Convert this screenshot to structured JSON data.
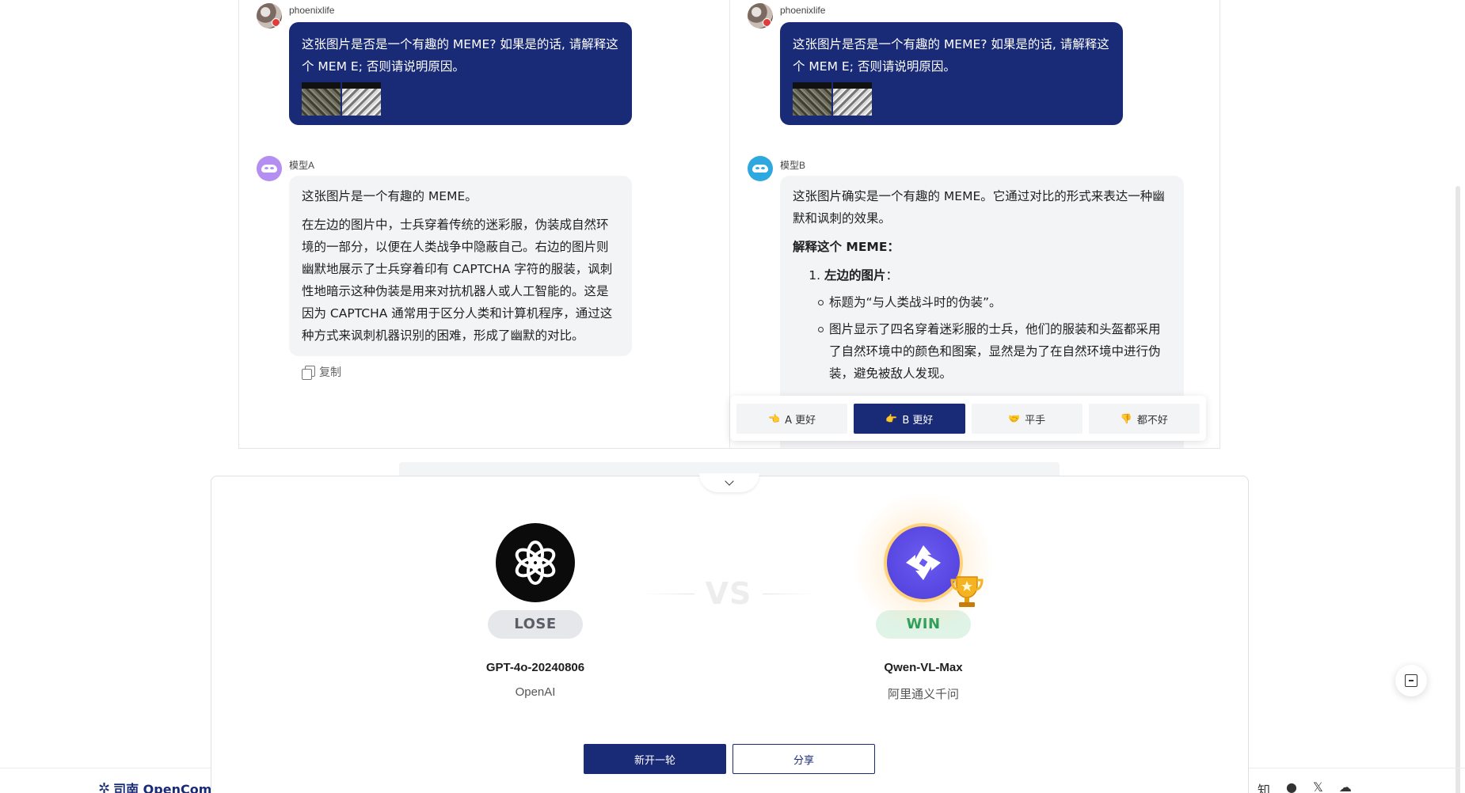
{
  "left_column": {
    "user": {
      "name": "phoenixlife",
      "message": "这张图片是否是一个有趣的 MEME? 如果是的话, 请解释这个 MEM E; 否则请说明原因。"
    },
    "model": {
      "name": "模型A",
      "paragraphs": [
        "这张图片是一个有趣的 MEME。",
        "在左边的图片中，士兵穿着传统的迷彩服，伪装成自然环境的一部分，以便在人类战争中隐蔽自己。右边的图片则幽默地展示了士兵穿着印有 CAPTCHA 字符的服装，讽刺性地暗示这种伪装是用来对抗机器人或人工智能的。这是因为 CAPTCHA 通常用于区分人类和计算机程序，通过这种方式来讽刺机器识别的困难，形成了幽默的对比。"
      ],
      "copy_label": "复制"
    }
  },
  "right_column": {
    "user": {
      "name": "phoenixlife",
      "message": "这张图片是否是一个有趣的 MEME? 如果是的话, 请解释这个 MEM E; 否则请说明原因。"
    },
    "model": {
      "name": "模型B",
      "intro": "这张图片确实是一个有趣的 MEME。它通过对比的形式来表达一种幽默和讽刺的效果。",
      "heading": "解释这个 MEME：",
      "list_item_1": "左边的图片",
      "list_item_1_suffix": "：",
      "bullets": [
        "标题为“与人类战斗时的伪装”。",
        "图片显示了四名穿着迷彩服的士兵，他们的服装和头盔都采用了自然环境中的颜色和图案，显然是为了在自然环境中进行伪装，避免被敌人发现。"
      ]
    }
  },
  "vote": {
    "buttons": [
      {
        "emoji": "👈",
        "label": "A 更好",
        "active": false
      },
      {
        "emoji": "👉",
        "label": "B 更好",
        "active": true
      },
      {
        "emoji": "🤝",
        "label": "平手",
        "active": false
      },
      {
        "emoji": "👎",
        "label": "都不好",
        "active": false
      }
    ]
  },
  "result": {
    "vs_text": "VS",
    "loser": {
      "badge": "LOSE",
      "name": "GPT-4o-20240806",
      "org": "OpenAI"
    },
    "winner": {
      "badge": "WIN",
      "name": "Qwen-VL-Max",
      "org": "阿里通义千问"
    },
    "new_round_label": "新开一轮",
    "share_label": "分享"
  },
  "footer": {
    "brand": "司南 OpenCompass",
    "icons": [
      "知",
      "github-icon",
      "x-icon",
      "wechat-icon"
    ]
  },
  "colors": {
    "primary": "#192a77",
    "win": "#1d9a52",
    "lose": "#5a5e66"
  }
}
